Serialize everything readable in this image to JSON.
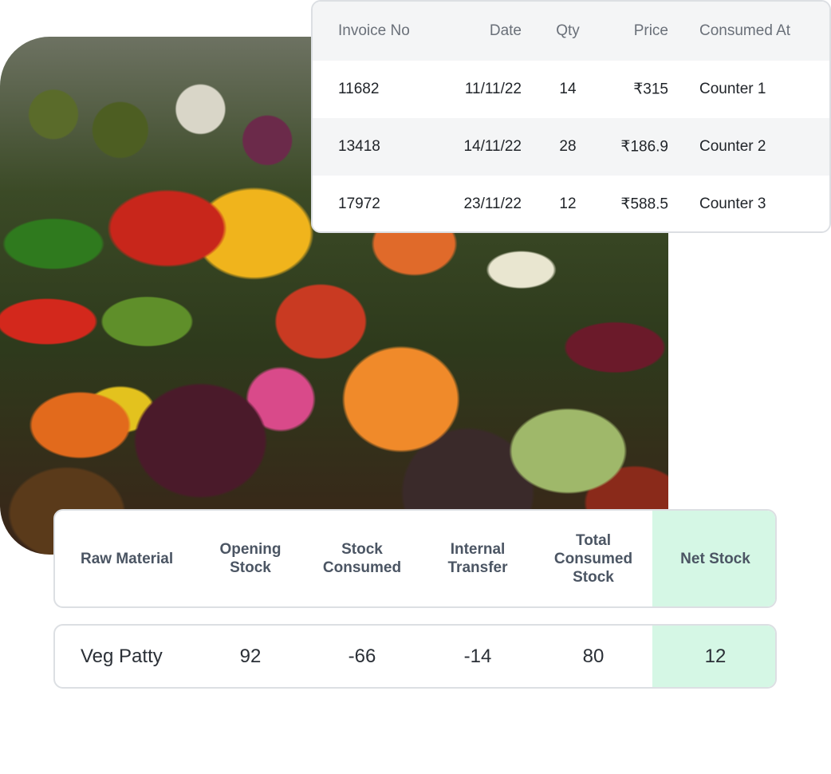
{
  "photo": {
    "description_icon": "produce-market-photo"
  },
  "invoices": {
    "headers": [
      "Invoice No",
      "Date",
      "Qty",
      "Price",
      "Consumed At"
    ],
    "rows": [
      [
        "11682",
        "11/11/22",
        "14",
        "₹315",
        "Counter 1"
      ],
      [
        "13418",
        "14/11/22",
        "28",
        "₹186.9",
        "Counter 2"
      ],
      [
        "17972",
        "23/11/22",
        "12",
        "₹588.5",
        "Counter 3"
      ]
    ]
  },
  "stock": {
    "headers": [
      "Raw Material",
      "Opening Stock",
      "Stock Consumed",
      "Internal Transfer",
      "Total Consumed Stock",
      "Net Stock"
    ],
    "row": [
      "Veg Patty",
      "92",
      "-66",
      "-14",
      "80",
      "12"
    ],
    "highlight_color": "#d5f7e5"
  }
}
